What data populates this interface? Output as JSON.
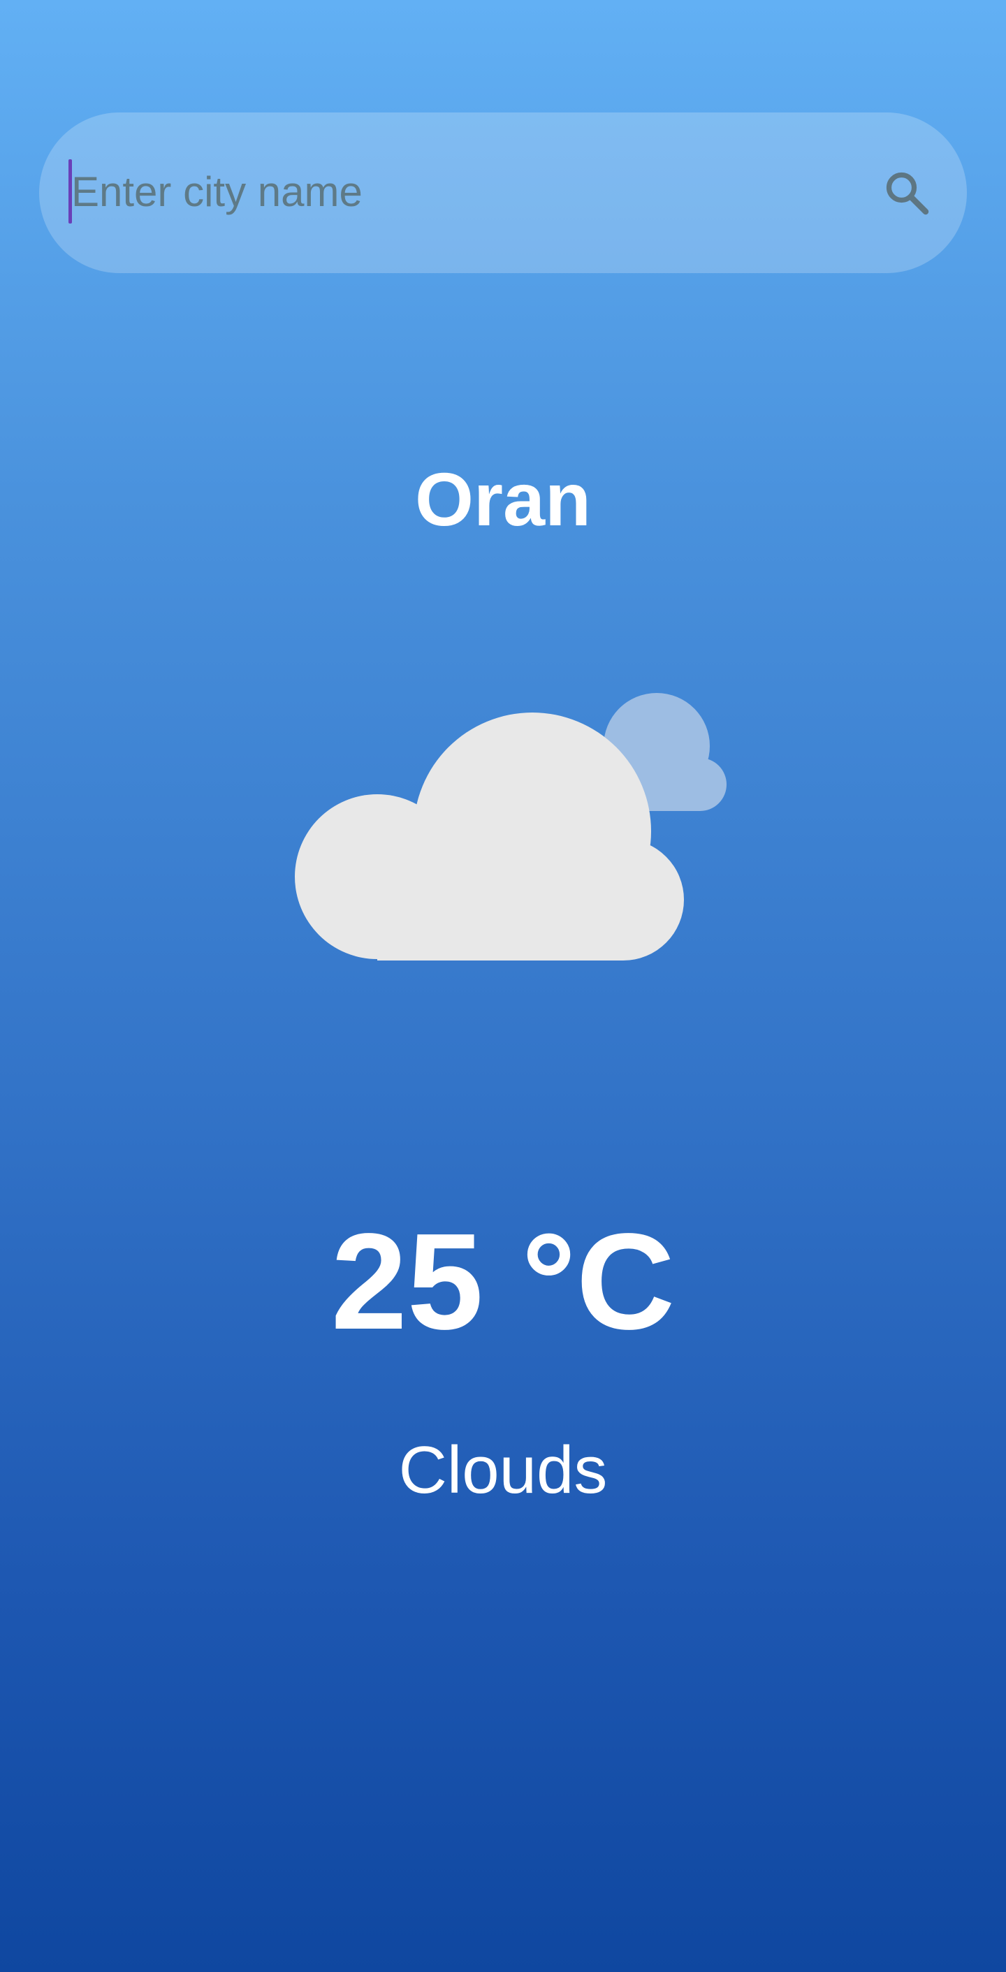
{
  "search": {
    "placeholder": "Enter city name",
    "value": "",
    "icon": "search-icon"
  },
  "weather": {
    "city": "Oran",
    "icon": "clouds-icon",
    "temperature": "25 °C",
    "condition": "Clouds"
  },
  "colors": {
    "background_top": "#62b0f4",
    "background_bottom": "#0f47a0",
    "text": "#ffffff",
    "caret": "#6a3fb8",
    "placeholder": "#5e7a87",
    "cloud_front": "#e8e8e8",
    "cloud_back": "#9dbde3"
  }
}
